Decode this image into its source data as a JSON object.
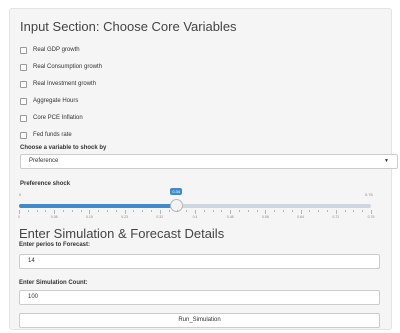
{
  "input_section": {
    "title": "Input Section: Choose Core Variables",
    "checkboxes": [
      "Real GDP growth",
      "Real Consumption growth",
      "Real Investment growth",
      "Aggregate Hours",
      "Core PCE Inflation",
      "Fed funds rate"
    ]
  },
  "shock": {
    "label": "Choose a variable to shock by",
    "selected": "Preference",
    "slider_label": "Preference shock",
    "min_label": "0",
    "max_label": "0.76",
    "value_label": "0.34",
    "value_fraction": 0.447,
    "tick_labels": [
      "0",
      "0.08",
      "0.15",
      "0.23",
      "0.32",
      "0.4",
      "0.48",
      "0.56",
      "0.64",
      "0.72",
      "0.76"
    ]
  },
  "simulation": {
    "title": "Enter Simulation & Forecast Details",
    "periods_label": "Enter perios to Forecast:",
    "periods_value": "14",
    "count_label": "Enter Simulation Count:",
    "count_value": "100",
    "run_label": "Run_Simulation"
  },
  "colors": {
    "accent": "#428bca",
    "panel_bg": "#f5f5f5"
  },
  "icons": {
    "select_caret": "chevron-down-icon"
  }
}
